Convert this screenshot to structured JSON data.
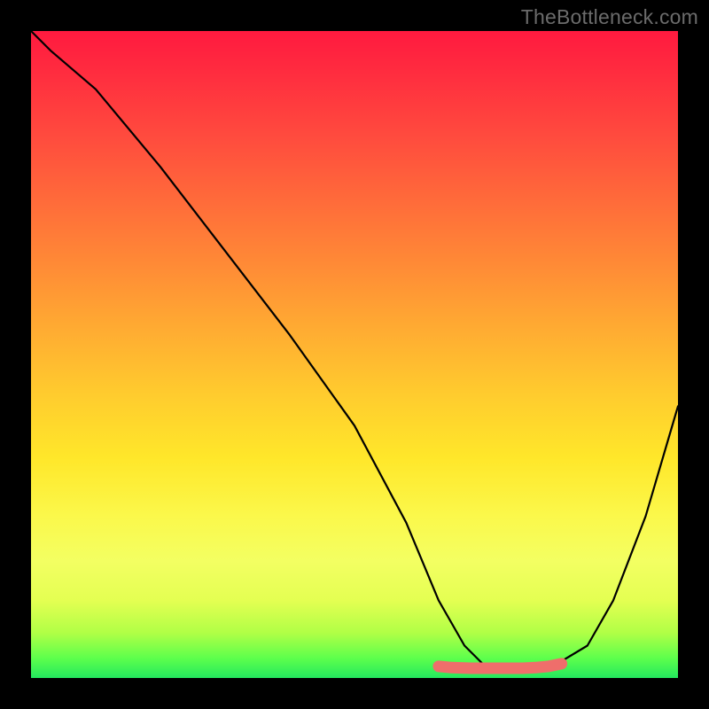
{
  "watermark": "TheBottleneck.com",
  "chart_data": {
    "type": "line",
    "title": "",
    "xlabel": "",
    "ylabel": "",
    "xlim": [
      0,
      100
    ],
    "ylim": [
      0,
      100
    ],
    "grid": false,
    "series": [
      {
        "name": "curve",
        "color": "#000000",
        "x": [
          0,
          3,
          10,
          20,
          30,
          40,
          50,
          58,
          63,
          67,
          70,
          73,
          77,
          81,
          86,
          90,
          95,
          100
        ],
        "values": [
          100,
          97,
          91,
          79,
          66,
          53,
          39,
          24,
          12,
          5,
          2,
          1.5,
          1.5,
          2,
          5,
          12,
          25,
          42
        ]
      },
      {
        "name": "highlight-band",
        "color": "#ef6e6b",
        "x": [
          63,
          65,
          68,
          70,
          72,
          74,
          76,
          78,
          80,
          82
        ],
        "values": [
          1.8,
          1.6,
          1.5,
          1.5,
          1.5,
          1.5,
          1.5,
          1.6,
          1.8,
          2.2
        ]
      }
    ],
    "gradient_stops": [
      {
        "pos": 0.0,
        "color": "#ff1a3f"
      },
      {
        "pos": 0.5,
        "color": "#ffbf30"
      },
      {
        "pos": 0.8,
        "color": "#f5ff58"
      },
      {
        "pos": 1.0,
        "color": "#24e85e"
      }
    ]
  }
}
